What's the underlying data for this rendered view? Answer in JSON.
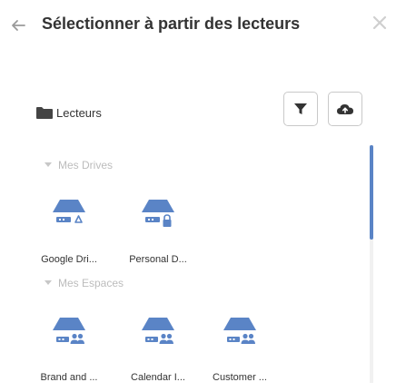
{
  "dialog": {
    "title": "Sélectionner à partir des lecteurs"
  },
  "toolbar": {
    "breadcrumb_label": "Lecteurs"
  },
  "sections": [
    {
      "heading": "Mes Drives",
      "items": [
        {
          "label": "Google Dri...",
          "icon": "shared-drive-google-icon"
        },
        {
          "label": "Personal D...",
          "icon": "shared-drive-locked-icon"
        }
      ]
    },
    {
      "heading": "Mes Espaces",
      "items": [
        {
          "label": "Brand and ...",
          "icon": "shared-drive-people-icon"
        },
        {
          "label": "Calendar I...",
          "icon": "shared-drive-people-icon"
        },
        {
          "label": "Customer ...",
          "icon": "shared-drive-people-icon"
        }
      ]
    }
  ],
  "colors": {
    "drive_icon": "#5a84c6",
    "section_heading": "#bcbcbc",
    "scrollbar": "#5a84c6"
  }
}
